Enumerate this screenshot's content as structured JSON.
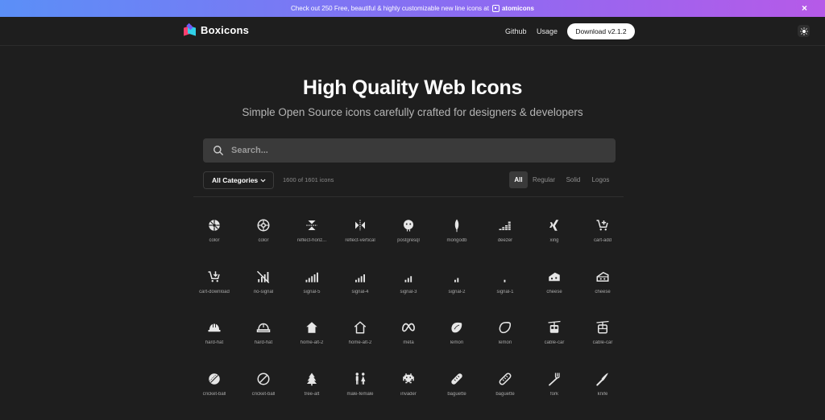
{
  "announcement": {
    "text": "Check out 250 Free, beautiful & highly customizable new line icons at",
    "brand": "atomicons",
    "close_label": "×"
  },
  "nav": {
    "logo": "Boxicons",
    "links": [
      "Github",
      "Usage"
    ],
    "download_label": "Download v2.1.2"
  },
  "hero": {
    "title": "High Quality Web Icons",
    "subtitle": "Simple Open Source icons carefully crafted for designers & developers"
  },
  "search": {
    "placeholder": "Search..."
  },
  "filters": {
    "category": "All Categories",
    "count": "1600 of 1601 icons",
    "types": [
      "All",
      "Regular",
      "Solid",
      "Logos"
    ],
    "active": "All"
  },
  "icons": [
    [
      "color",
      "color",
      "reflect-horiz...",
      "reflect-vertical",
      "postgresql",
      "mongodb",
      "deezer",
      "xing",
      "cart-add"
    ],
    [
      "cart-download",
      "no-signal",
      "signal-5",
      "signal-4",
      "signal-3",
      "signal-2",
      "signal-1",
      "cheese",
      "cheese"
    ],
    [
      "hard-hat",
      "hard-hat",
      "home-alt-2",
      "home-alt-2",
      "meta",
      "lemon",
      "lemon",
      "cable-car",
      "cable-car"
    ],
    [
      "cricket-ball",
      "cricket-ball",
      "tree-alt",
      "male-female",
      "invader",
      "baguette",
      "baguette",
      "fork",
      "knife"
    ]
  ],
  "colors": {
    "background": "#1e1e1e",
    "banner_start": "#5b8ff7",
    "banner_end": "#b65ae8",
    "icon": "#e6e6e6"
  }
}
